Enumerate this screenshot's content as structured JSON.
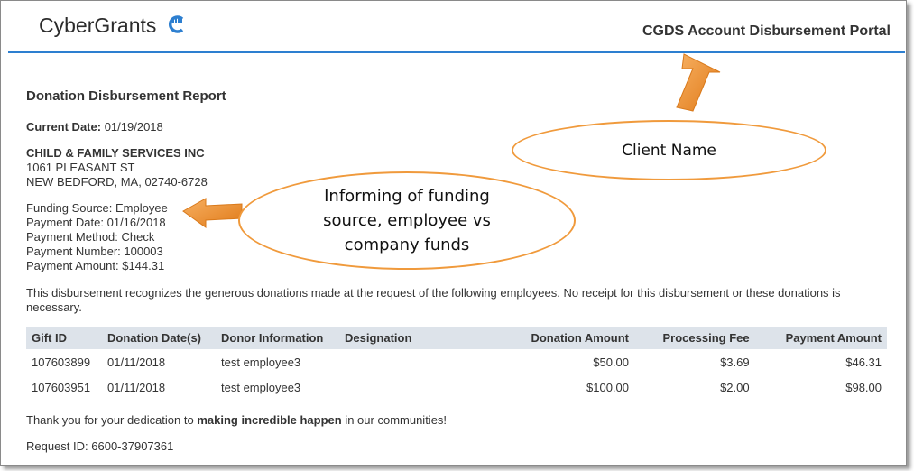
{
  "header": {
    "brand": "CyberGrants",
    "portal_title": "CGDS Account Disbursement Portal"
  },
  "report": {
    "title": "Donation Disbursement Report",
    "current_date_label": "Current Date:",
    "current_date": "01/19/2018"
  },
  "client": {
    "name": "CHILD & FAMILY SERVICES INC",
    "address1": "1061 PLEASANT ST",
    "address2": "NEW BEDFORD, MA, 02740-6728"
  },
  "funding": {
    "source": "Funding Source: Employee",
    "payment_date": "Payment Date: 01/16/2018",
    "payment_method": "Payment Method: Check",
    "payment_number": "Payment Number: 100003",
    "payment_amount": "Payment Amount: $144.31"
  },
  "message": "This disbursement recognizes the generous donations made at the request of the following employees. No receipt for this disbursement or these donations is necessary.",
  "table": {
    "headers": [
      "Gift ID",
      "Donation Date(s)",
      "Donor Information",
      "Designation",
      "Donation Amount",
      "Processing Fee",
      "Payment Amount"
    ],
    "rows": [
      [
        "107603899",
        "01/11/2018",
        "test employee3",
        "",
        "$50.00",
        "$3.69",
        "$46.31"
      ],
      [
        "107603951",
        "01/11/2018",
        "test employee3",
        "",
        "$100.00",
        "$2.00",
        "$98.00"
      ]
    ]
  },
  "footer": {
    "thanks_pre": "Thank you for your dedication to ",
    "thanks_bold": "making incredible happen",
    "thanks_post": " in our communities!",
    "request_id": "Request ID: 6600-37907361"
  },
  "callouts": {
    "client": "Client Name",
    "funding_line1": "Informing of funding",
    "funding_line2": "source, employee vs",
    "funding_line3": "company funds"
  },
  "colors": {
    "accent_blue": "#2d7fd0",
    "callout_orange": "#f09a3c",
    "table_header": "#dde3ea"
  }
}
